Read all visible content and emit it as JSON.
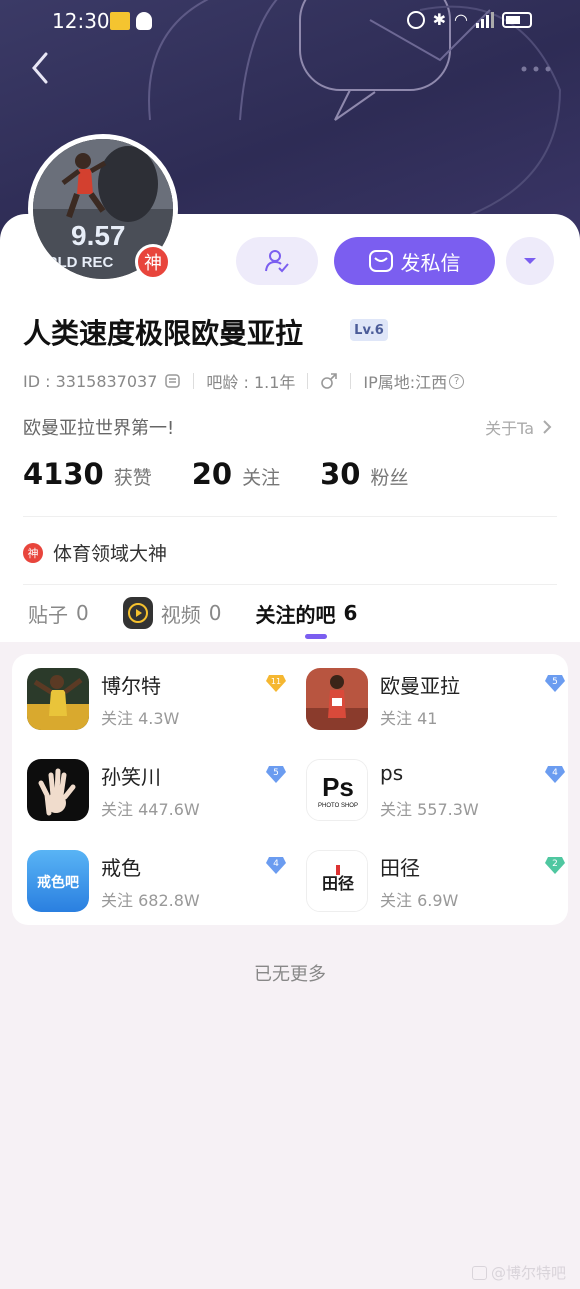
{
  "status_bar": {
    "time": "12:30"
  },
  "profile": {
    "avatar_text": "9.57",
    "avatar_subtext": "ORLD REC",
    "shen_badge": "神",
    "username": "人类速度极限欧曼亚拉",
    "level": "Lv.6",
    "message_button": "发私信",
    "id_text": "ID : 3315837037",
    "age_text": "吧龄 : 1.1年",
    "gender_icon": "male-icon",
    "ip_text": "IP属地:江西",
    "bio": "欧曼亚拉世界第一!",
    "about_label": "关于Ta"
  },
  "stats": [
    {
      "value": "4130",
      "label": "获赞"
    },
    {
      "value": "20",
      "label": "关注"
    },
    {
      "value": "30",
      "label": "粉丝"
    }
  ],
  "honor": {
    "icon_text": "神",
    "label": "体育领域大神"
  },
  "tabs": [
    {
      "label": "贴子",
      "count": "0"
    },
    {
      "label": "视频",
      "count": "0"
    },
    {
      "label": "关注的吧",
      "count": "6"
    }
  ],
  "bars": [
    {
      "name": "博尔特",
      "follow": "关注 4.3W",
      "level": "11",
      "level_color": "#f5b731"
    },
    {
      "name": "欧曼亚拉",
      "follow": "关注 41",
      "level": "5",
      "level_color": "#6b9cf0"
    },
    {
      "name": "孙笑川",
      "follow": "关注 447.6W",
      "level": "5",
      "level_color": "#6b9cf0"
    },
    {
      "name": "ps",
      "follow": "关注 557.3W",
      "level": "4",
      "level_color": "#6b9cf0"
    },
    {
      "name": "戒色",
      "follow": "关注 682.8W",
      "level": "4",
      "level_color": "#6b9cf0"
    },
    {
      "name": "田径",
      "follow": "关注 6.9W",
      "level": "2",
      "level_color": "#4fc7a0"
    }
  ],
  "thumb_texts": {
    "ps_main": "Ps",
    "ps_sub": "PHOTO SHOP",
    "jiese": "戒色吧",
    "tianjing": "田径"
  },
  "footer": {
    "no_more": "已无更多",
    "watermark": "@博尔特吧"
  },
  "colors": {
    "accent": "#7b5ef0",
    "header": "#33315c"
  }
}
